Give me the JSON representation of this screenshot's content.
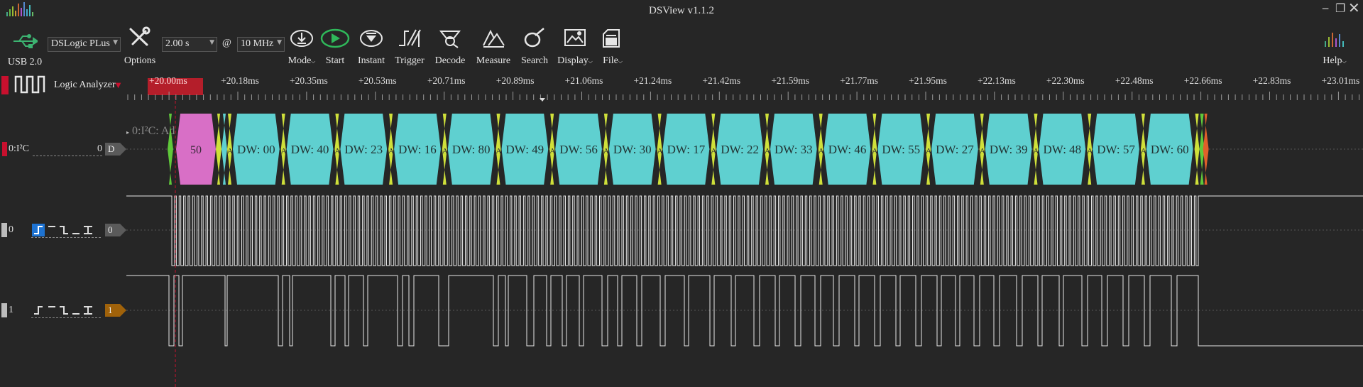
{
  "window": {
    "title": "DSView v1.1.2"
  },
  "toolbar": {
    "device_connection": "USB 2.0",
    "device_name": "DSLogic PLus",
    "options_label": "Options",
    "duration": "2.00 s",
    "at_symbol": "@",
    "sample_rate": "10 MHz",
    "buttons": [
      {
        "label": "Mode",
        "icon": "download-circle-icon"
      },
      {
        "label": "Start",
        "icon": "play-icon"
      },
      {
        "label": "Instant",
        "icon": "instant-capture-icon"
      },
      {
        "label": "Trigger",
        "icon": "trigger-icon"
      },
      {
        "label": "Decode",
        "icon": "decode-icon"
      },
      {
        "label": "Measure",
        "icon": "measure-icon"
      },
      {
        "label": "Search",
        "icon": "search-icon"
      },
      {
        "label": "Display",
        "icon": "display-icon"
      },
      {
        "label": "File",
        "icon": "file-icon"
      }
    ],
    "help_label": "Help"
  },
  "mode_panel": {
    "label": "Logic Analyzer"
  },
  "ruler": {
    "cursor_label": "+20.00ms",
    "ticks": [
      "+20.18ms",
      "+20.35ms",
      "+20.53ms",
      "+20.71ms",
      "+20.89ms",
      "+21.06ms",
      "+21.24ms",
      "+21.42ms",
      "+21.59ms",
      "+21.77ms",
      "+21.95ms",
      "+22.13ms",
      "+22.30ms",
      "+22.48ms",
      "+22.66ms",
      "+22.83ms",
      "+23.01ms"
    ]
  },
  "decoder_row": {
    "index_name": "0:I²C",
    "value": "0",
    "badge": "D",
    "ghost_label": "0:I²C: Ad",
    "address_segment": "50",
    "data_segments": [
      "DW: 00",
      "DW: 40",
      "DW: 23",
      "DW: 16",
      "DW: 80",
      "DW: 49",
      "DW: 56",
      "DW: 30",
      "DW: 17",
      "DW: 22",
      "DW: 33",
      "DW: 46",
      "DW: 55",
      "DW: 27",
      "DW: 39",
      "DW: 48",
      "DW: 57",
      "DW: 60"
    ],
    "ack_letter": "A",
    "colors": {
      "address": "#d86fc6",
      "data": "#5fd0d0",
      "ack": "#cfe03a",
      "start": "#5fc83a",
      "stop": "#e0602a"
    }
  },
  "channels": [
    {
      "number": "0",
      "badge": "0",
      "badge_color": "#5a5a5a"
    },
    {
      "number": "1",
      "badge": "1",
      "badge_color": "#a0620a"
    }
  ],
  "trigger_icon_names": [
    "rising-edge-icon",
    "high-level-icon",
    "falling-edge-icon",
    "low-level-icon",
    "any-edge-icon"
  ]
}
